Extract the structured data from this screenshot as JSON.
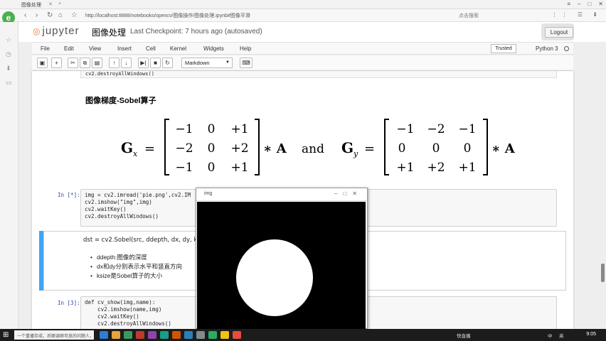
{
  "browser": {
    "tab_title": "图像处理",
    "url": "http://localhost:8888/notebooks/opencv/图像操作/图像处理.ipynb#图像平滑",
    "search_placeholder": "点击搜索",
    "window_controls": [
      "≡",
      "–",
      "□",
      "✕"
    ],
    "icons": [
      "back-icon",
      "forward-icon",
      "refresh-icon",
      "home-icon",
      "star-icon"
    ]
  },
  "jupyter": {
    "logo_text": "jupyter",
    "notebook_name": "图像处理",
    "checkpoint": "Last Checkpoint: 7 hours ago (autosaved)",
    "logout_label": "Logout",
    "menu": [
      "File",
      "Edit",
      "View",
      "Insert",
      "Cell",
      "Kernel",
      "Widgets",
      "Help"
    ],
    "trusted_label": "Trusted",
    "kernel_name": "Python 3",
    "cell_type": "Markdown",
    "toolbar_icons": [
      "save-icon",
      "plus-icon",
      "cut-icon",
      "copy-icon",
      "paste-icon",
      "arrow-up-icon",
      "arrow-down-icon",
      "step-forward-icon",
      "stop-icon",
      "restart-icon",
      "keyboard-icon"
    ],
    "toolbar_glyphs": [
      "▣",
      "+",
      "✂",
      "⧉",
      "▤",
      "↑",
      "↓",
      "▶|",
      "■",
      "↻",
      "⌨"
    ]
  },
  "cells": {
    "prev_code_tail": "cv2.destroyAllWindows()",
    "heading": "图像梯度-Sobel算子",
    "formula": {
      "gx_label": "G",
      "gx_sub": "x",
      "gy_label": "G",
      "gy_sub": "y",
      "gx_matrix": [
        [
          "−1",
          "0",
          "+1"
        ],
        [
          "−2",
          "0",
          "+2"
        ],
        [
          "−1",
          "0",
          "+1"
        ]
      ],
      "gy_matrix": [
        [
          "−1",
          "−2",
          "−1"
        ],
        [
          "0",
          "0",
          "0"
        ],
        [
          "+1",
          "+2",
          "+1"
        ]
      ],
      "and_text": "and",
      "times_a": "∗ A",
      "equals": "="
    },
    "cell2_prompt": "In [*]:",
    "cell2_lines": [
      "img = cv2.imread('pie.png',cv2.IM",
      "cv2.imshow(\"img\",img)",
      "cv2.waitKey()",
      "cv2.destroyAllWindows()"
    ],
    "md_sig": "dst = cv2.Sobel(src, ddepth, dx, dy, k",
    "md_bullets": [
      "ddepth:图像的深度",
      "dx和dy分别表示水平和竖直方向",
      "ksize是Sobel算子的大小"
    ],
    "cell3_prompt": "In [3]:",
    "cell3_lines": [
      "def cv_show(img,name):",
      "    cv2.imshow(name,img)",
      "    cv2.waitKey()",
      "    cv2.destroyAllWindows()"
    ]
  },
  "popup": {
    "title": "img",
    "controls": [
      "–",
      "□",
      "✕"
    ],
    "image_description_colors": {
      "background": "#000000",
      "circle": "#ffffff"
    }
  },
  "taskbar": {
    "search_text": "一个重播存成，后面调继可息的问题人，那么这么多的话就是...",
    "tray_items": [
      "快直播",
      "中",
      "英"
    ],
    "clock": "9:05"
  },
  "colors": {
    "selection_bar": "#42a5f5",
    "jupyter_orange": "#f37726",
    "prompt_blue": "#303f9f"
  }
}
